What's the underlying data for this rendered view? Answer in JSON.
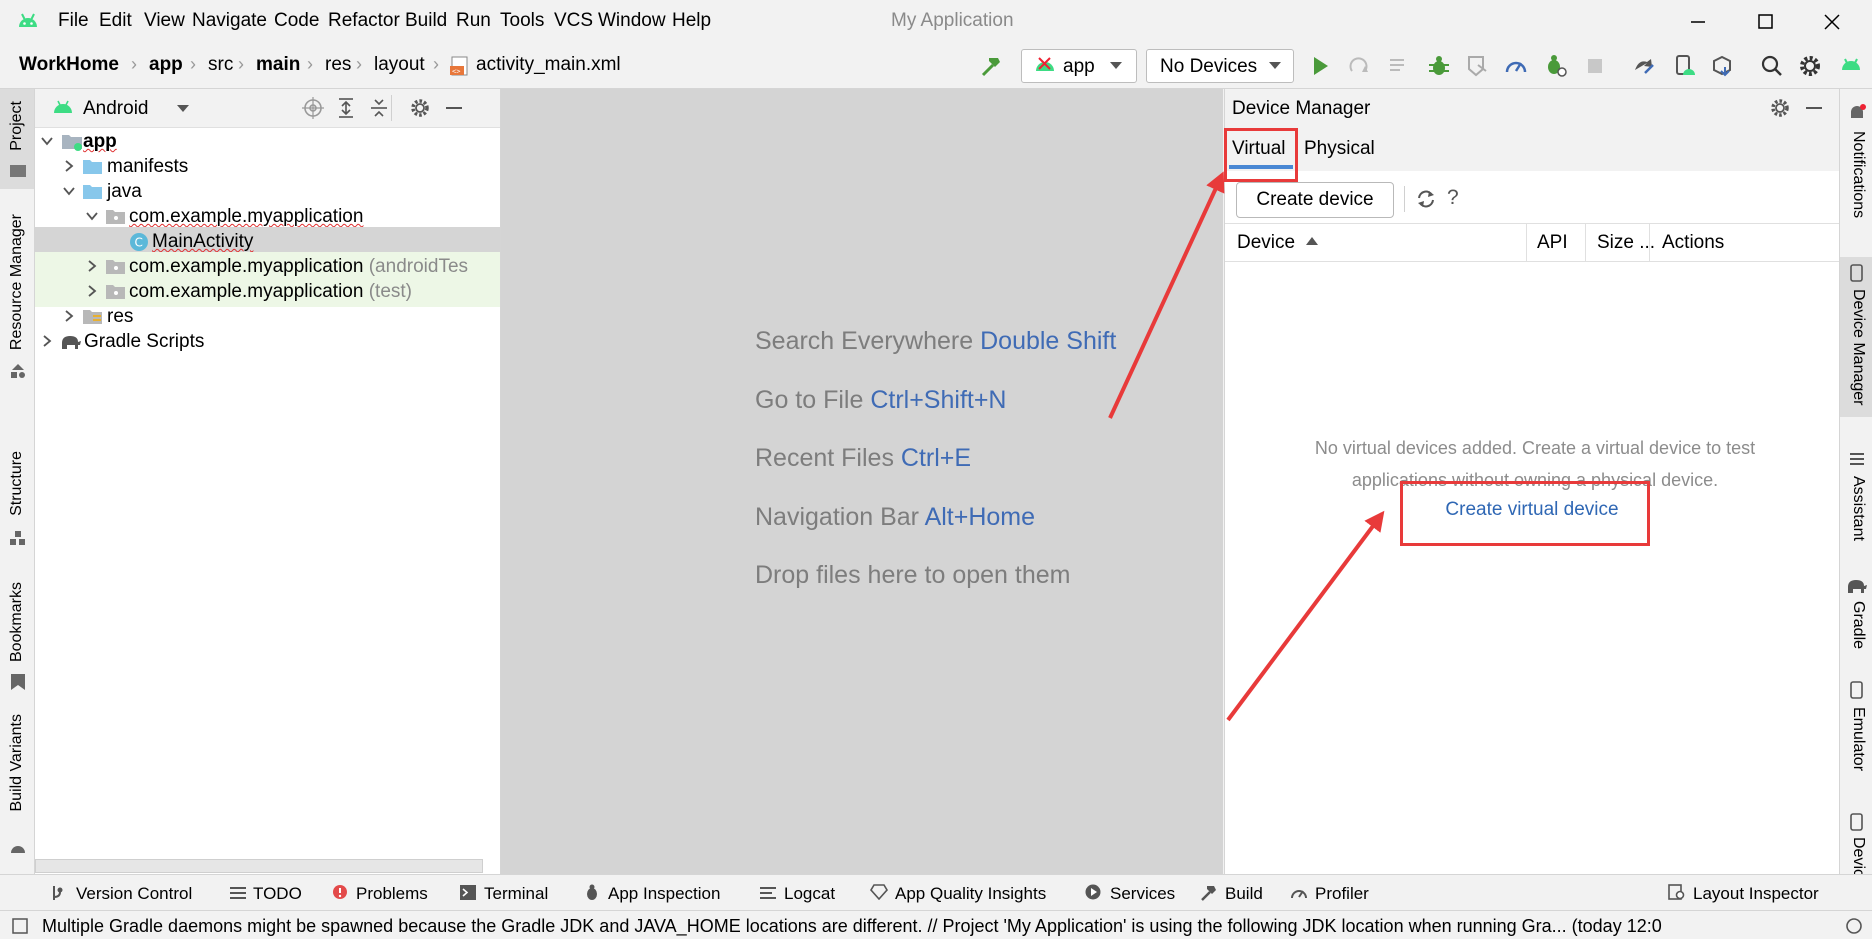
{
  "menu": {
    "items": [
      "File",
      "Edit",
      "View",
      "Navigate",
      "Code",
      "Refactor",
      "Build",
      "Run",
      "Tools",
      "VCS",
      "Window",
      "Help"
    ],
    "app_title": "My Application"
  },
  "breadcrumb": [
    "WorkHome",
    "app",
    "src",
    "main",
    "res",
    "layout",
    "activity_main.xml"
  ],
  "toolbar": {
    "run_config": "app",
    "device_selector": "No Devices"
  },
  "left_stripe": [
    "Project",
    "Resource Manager",
    "Structure",
    "Bookmarks",
    "Build Variants"
  ],
  "project": {
    "view_mode": "Android",
    "tree": [
      {
        "label": "app",
        "bold": true
      },
      {
        "label": "manifests"
      },
      {
        "label": "java"
      },
      {
        "label": "com.example.myapplication"
      },
      {
        "label": "MainActivity"
      },
      {
        "label": "com.example.myapplication",
        "suffix": "(androidTes"
      },
      {
        "label": "com.example.myapplication",
        "suffix": "(test)"
      },
      {
        "label": "res"
      },
      {
        "label": "Gradle Scripts"
      }
    ]
  },
  "editor": {
    "hints": [
      {
        "text": "Search Everywhere",
        "key": "Double Shift"
      },
      {
        "text": "Go to File",
        "key": "Ctrl+Shift+N"
      },
      {
        "text": "Recent Files",
        "key": "Ctrl+E"
      },
      {
        "text": "Navigation Bar",
        "key": "Alt+Home"
      },
      {
        "text": "Drop files here to open them",
        "key": ""
      }
    ]
  },
  "device_manager": {
    "title": "Device Manager",
    "tabs": [
      "Virtual",
      "Physical"
    ],
    "create_device_label": "Create device",
    "columns": [
      "Device",
      "API",
      "Size ...",
      "Actions"
    ],
    "empty_line1": "No virtual devices added. Create a virtual device to test",
    "empty_line2": "applications without owning a physical device.",
    "create_virtual_link": "Create virtual device"
  },
  "right_stripe": [
    "Notifications",
    "Device Manager",
    "Assistant",
    "Gradle",
    "Emulator",
    "Devic"
  ],
  "bottom_tools": [
    "Version Control",
    "TODO",
    "Problems",
    "Terminal",
    "App Inspection",
    "Logcat",
    "App Quality Insights",
    "Services",
    "Build",
    "Profiler",
    "Layout Inspector"
  ],
  "status": {
    "message": "Multiple Gradle daemons might be spawned because the Gradle JDK and JAVA_HOME locations are different. // Project 'My Application' is using the following JDK location when running Gra... (today 12:0"
  },
  "colors": {
    "accent": "#3f6bb5",
    "annotation": "#e83a3a",
    "android_green": "#3ddc84"
  }
}
